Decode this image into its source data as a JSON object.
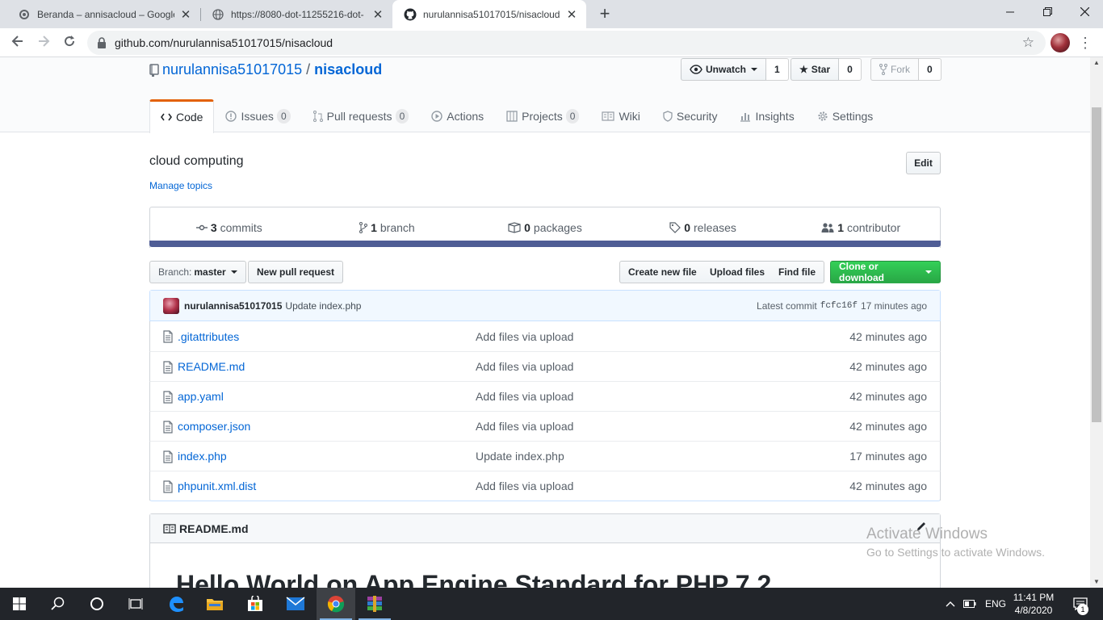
{
  "browser": {
    "tabs": [
      {
        "title": "Beranda – annisacloud – Google",
        "close": "✕"
      },
      {
        "title": "https://8080-dot-11255216-dot-",
        "close": "✕"
      },
      {
        "title": "nurulannisa51017015/nisacloud:",
        "close": "✕"
      }
    ],
    "new_tab": "+",
    "url": "github.com/nurulannisa51017015/nisacloud"
  },
  "repo": {
    "owner": "nurulannisa51017015",
    "separator": "/",
    "name": "nisacloud",
    "watch_label": "Unwatch",
    "watch_count": "1",
    "star_label": "Star",
    "star_count": "0",
    "fork_label": "Fork",
    "fork_count": "0"
  },
  "nav": {
    "code": "Code",
    "issues": "Issues",
    "issues_count": "0",
    "pulls": "Pull requests",
    "pulls_count": "0",
    "actions": "Actions",
    "projects": "Projects",
    "projects_count": "0",
    "wiki": "Wiki",
    "security": "Security",
    "insights": "Insights",
    "settings": "Settings"
  },
  "about": {
    "description": "cloud computing",
    "manage_topics": "Manage topics",
    "edit": "Edit"
  },
  "summary": {
    "commits_num": "3",
    "commits_label": "commits",
    "branch_num": "1",
    "branch_label": "branch",
    "packages_num": "0",
    "packages_label": "packages",
    "releases_num": "0",
    "releases_label": "releases",
    "contributors_num": "1",
    "contributors_label": "contributor",
    "language_color": "#4F5D95"
  },
  "toolbar": {
    "branch_prefix": "Branch:",
    "branch_name": "master",
    "new_pr": "New pull request",
    "create_file": "Create new file",
    "upload_files": "Upload files",
    "find_file": "Find file",
    "clone": "Clone or download"
  },
  "latest_commit": {
    "author": "nurulannisa51017015",
    "message": "Update index.php",
    "prefix": "Latest commit",
    "sha": "fcfc16f",
    "age": "17 minutes ago"
  },
  "files": [
    {
      "name": ".gitattributes",
      "message": "Add files via upload",
      "age": "42 minutes ago"
    },
    {
      "name": "README.md",
      "message": "Add files via upload",
      "age": "42 minutes ago"
    },
    {
      "name": "app.yaml",
      "message": "Add files via upload",
      "age": "42 minutes ago"
    },
    {
      "name": "composer.json",
      "message": "Add files via upload",
      "age": "42 minutes ago"
    },
    {
      "name": "index.php",
      "message": "Update index.php",
      "age": "17 minutes ago"
    },
    {
      "name": "phpunit.xml.dist",
      "message": "Add files via upload",
      "age": "42 minutes ago"
    }
  ],
  "readme": {
    "title": "README.md",
    "heading": "Hello World on App Engine Standard for PHP 7.2"
  },
  "watermark": {
    "line1": "Activate Windows",
    "line2": "Go to Settings to activate Windows."
  },
  "taskbar": {
    "lang": "ENG",
    "time": "11:41 PM",
    "date": "4/8/2020",
    "notifications": "1"
  },
  "colors": {
    "link": "#0366d6",
    "green_button": "#28a745",
    "nav_selected_accent": "#e36209"
  }
}
